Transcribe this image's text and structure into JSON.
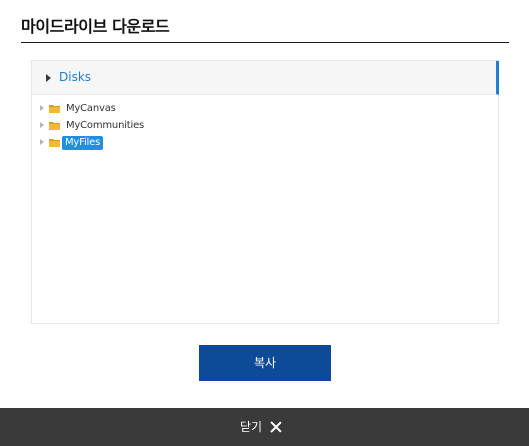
{
  "dialog": {
    "title": "마이드라이브 다운로드"
  },
  "tree": {
    "root_label": "Disks",
    "items": [
      {
        "label": "MyCanvas",
        "icon": "folder-icon",
        "selected": false
      },
      {
        "label": "MyCommunities",
        "icon": "folder-icon",
        "selected": false
      },
      {
        "label": "MyFiles",
        "icon": "folder-icon",
        "selected": true
      }
    ]
  },
  "actions": {
    "copy_label": "복사",
    "close_label": "닫기"
  },
  "colors": {
    "accent": "#1f7fd1",
    "selection": "#1f8fe3",
    "primary_button": "#0d4a97",
    "footer": "#3a3a3a",
    "folder": "#e8b43a"
  }
}
